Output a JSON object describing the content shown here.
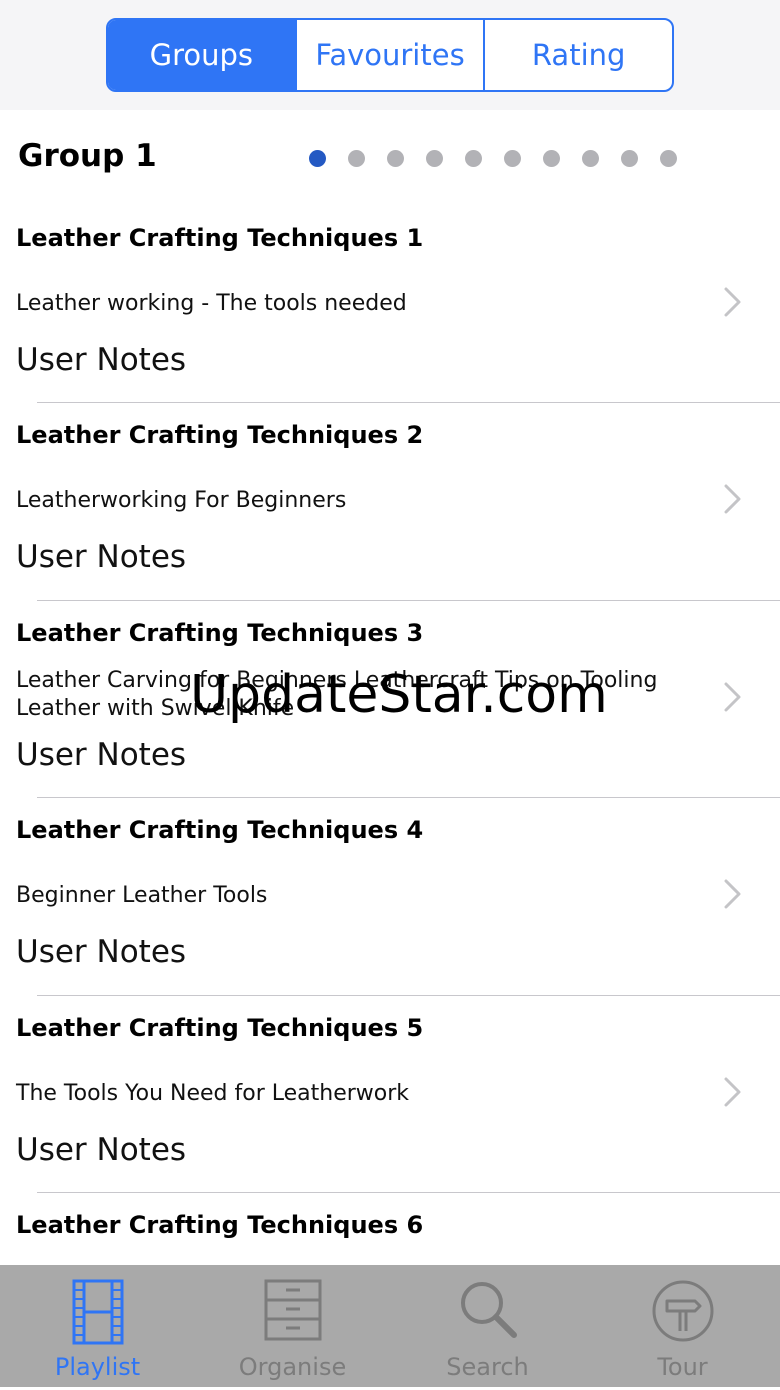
{
  "segmented": {
    "items": [
      "Groups",
      "Favourites",
      "Rating"
    ],
    "selected": "Groups"
  },
  "group": {
    "title": "Group 1",
    "page_count": 10,
    "current_page": 1
  },
  "list": {
    "items": [
      {
        "title": "Leather Crafting Techniques 1",
        "subtitle": "Leather working - The tools needed",
        "notes": "User Notes"
      },
      {
        "title": "Leather Crafting Techniques 2",
        "subtitle": "Leatherworking For Beginners",
        "notes": "User Notes"
      },
      {
        "title": "Leather Crafting Techniques 3",
        "subtitle": "Leather Carving for Beginners Leathercraft Tips on Tooling Leather with Swivel Knife",
        "notes": "User Notes"
      },
      {
        "title": "Leather Crafting Techniques 4",
        "subtitle": "Beginner Leather Tools",
        "notes": "User Notes"
      },
      {
        "title": "Leather Crafting Techniques 5",
        "subtitle": "The Tools You Need for Leatherwork",
        "notes": "User Notes"
      },
      {
        "title": "Leather Crafting Techniques 6",
        "subtitle": "",
        "notes": ""
      }
    ]
  },
  "watermark": "UpdateStar.com",
  "tabbar": {
    "items": [
      {
        "label": "Playlist",
        "icon": "film-strip-icon",
        "active": true
      },
      {
        "label": "Organise",
        "icon": "cabinet-icon",
        "active": false
      },
      {
        "label": "Search",
        "icon": "search-icon",
        "active": false
      },
      {
        "label": "Tour",
        "icon": "signpost-icon",
        "active": false
      }
    ]
  },
  "colors": {
    "accent": "#2f75f5",
    "active_dot": "#2459c3",
    "inactive_dot": "#b2b2b6",
    "tabbar_bg": "#a9a9a9",
    "tab_inactive": "#7c7c7c"
  }
}
